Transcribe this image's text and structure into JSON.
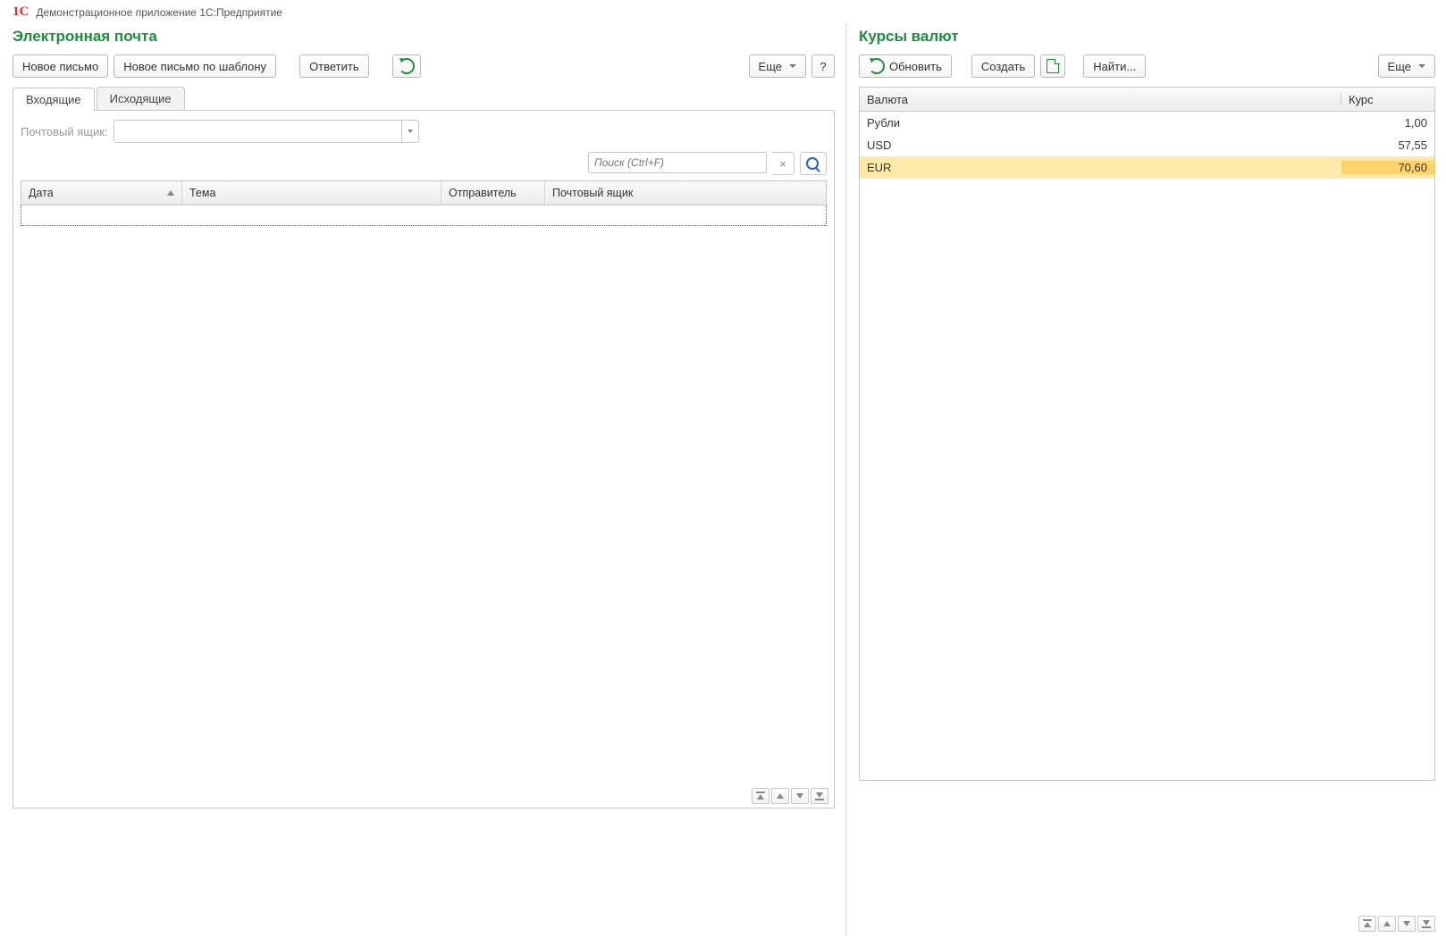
{
  "app": {
    "title": "Демонстрационное приложение 1С:Предприятие",
    "logo_text": "1C"
  },
  "email": {
    "title": "Электронная почта",
    "toolbar": {
      "new_message": "Новое письмо",
      "new_from_template": "Новое письмо по шаблону",
      "reply": "Ответить",
      "more": "Еще",
      "help": "?"
    },
    "tabs": {
      "inbox": "Входящие",
      "outbox": "Исходящие"
    },
    "mailbox_label": "Почтовый ящик:",
    "search_placeholder": "Поиск (Ctrl+F)",
    "columns": {
      "date": "Дата",
      "subject": "Тема",
      "sender": "Отправитель",
      "mailbox": "Почтовый ящик"
    }
  },
  "rates": {
    "title": "Курсы валют",
    "toolbar": {
      "refresh": "Обновить",
      "create": "Создать",
      "find": "Найти...",
      "more": "Еще"
    },
    "columns": {
      "currency": "Валюта",
      "rate": "Курс"
    },
    "rows": [
      {
        "currency": "Рубли",
        "rate": "1,00"
      },
      {
        "currency": "USD",
        "rate": "57,55"
      },
      {
        "currency": "EUR",
        "rate": "70,60"
      }
    ]
  }
}
